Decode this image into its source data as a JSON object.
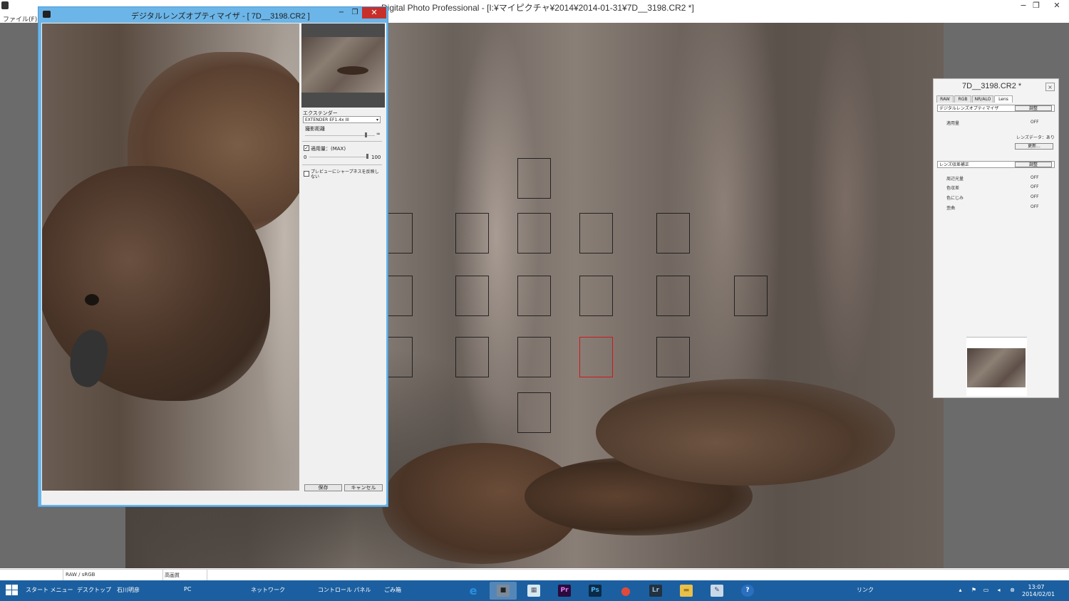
{
  "app": {
    "title": "Digital Photo Professional - [I:¥マイピクチャ¥2014¥2014-01-31¥7D__3198.CR2 *]",
    "menu_file": "ファイル(F)",
    "minimize": "−",
    "maximize": "❐",
    "close": "✕"
  },
  "dlo": {
    "title": "デジタルレンズオプティマイザ - [ 7D__3198.CR2 ]",
    "extender_label": "エクステンダー",
    "extender_value": "EXTENDER EF1.4x III",
    "distance_label": "撮影距離",
    "infinity": "∞",
    "amount_label": "適用量：(MAX)",
    "amount_checked": true,
    "amount_min": "0",
    "amount_max": "100",
    "preview_label": "プレビューにシャープネスを反映しない",
    "save": "保存",
    "cancel": "キャンセル",
    "minimize": "−",
    "maximize": "❐",
    "close": "✕"
  },
  "palette": {
    "title": "7D__3198.CR2 *",
    "close": "×",
    "tabs": [
      "RAW",
      "RGB",
      "NR/ALO",
      "Lens"
    ],
    "active_tab": "Lens",
    "dlo_section": "デジタルレンズオプティマイザ",
    "adjust": "調整",
    "amount_label": "適用量",
    "amount_value": "OFF",
    "lens_data": "レンズデータ：あり",
    "update": "更新...",
    "aberration_section": "レンズ収差補正",
    "rows": [
      {
        "label": "周辺光量",
        "value": "OFF"
      },
      {
        "label": "色収差",
        "value": "OFF"
      },
      {
        "label": "色にじみ",
        "value": "OFF"
      },
      {
        "label": "歪曲",
        "value": "OFF"
      }
    ]
  },
  "status": {
    "color_space": "RAW / sRGB",
    "quality": "高画質"
  },
  "taskbar": {
    "start": "スタート メニュー",
    "desktop": "デスクトップ",
    "user": "石川明彦",
    "pc": "PC",
    "network": "ネットワーク",
    "control_panel": "コントロール パネル",
    "recycle": "ごみ箱",
    "links": "リンク",
    "time": "13:07",
    "date": "2014/02/01",
    "apps": [
      {
        "name": "ie",
        "glyph": "e",
        "color": "#2a8fe0"
      },
      {
        "name": "dpp",
        "glyph": "■",
        "color": "#7b8a9a"
      },
      {
        "name": "explorer-photos",
        "glyph": "▦",
        "color": "#d8e8f0"
      },
      {
        "name": "premiere",
        "glyph": "Pr",
        "color": "#2b0a3d"
      },
      {
        "name": "photoshop",
        "glyph": "Ps",
        "color": "#0b2a47"
      },
      {
        "name": "chrome",
        "glyph": "●",
        "color": "#e04a3a"
      },
      {
        "name": "lightroom",
        "glyph": "Lr",
        "color": "#21313f"
      },
      {
        "name": "file-explorer",
        "glyph": "▬",
        "color": "#e8c04a"
      },
      {
        "name": "paint",
        "glyph": "✎",
        "color": "#c9d8e8"
      },
      {
        "name": "skype-like",
        "glyph": "?",
        "color": "#2a6fc0"
      }
    ]
  }
}
